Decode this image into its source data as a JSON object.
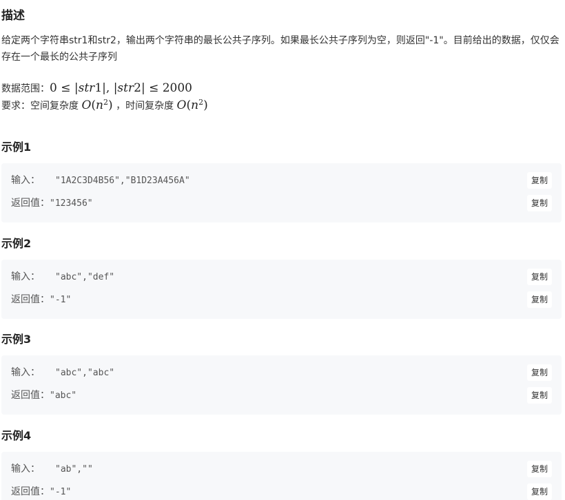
{
  "description": {
    "heading": "描述",
    "text": "给定两个字符串str1和str2，输出两个字符串的最长公共子序列。如果最长公共子序列为空，则返回\"-1\"。目前给出的数据，仅仅会存在一个最长的公共子序列",
    "range_label": "数据范围：",
    "range_math": {
      "lhs": "0",
      "le1": "≤",
      "bar_open1": "|",
      "var1": "str",
      "num1": "1",
      "bar_close1": "|",
      "comma": ",",
      "bar_open2": "|",
      "var2": "str",
      "num2": "2",
      "bar_close2": "|",
      "le2": "≤",
      "rhs": "2000"
    },
    "requirement_label": "要求：空间复杂度",
    "space_complexity": {
      "O": "O",
      "open": "(",
      "n": "n",
      "exp": "2",
      "close": ")"
    },
    "time_label": "，时间复杂度",
    "time_complexity": {
      "O": "O",
      "open": "(",
      "n": "n",
      "exp": "2",
      "close": ")"
    }
  },
  "examples": [
    {
      "title": "示例1",
      "input_label": "输入：",
      "input_value": "\"1A2C3D4B56\",\"B1D23A456A\"",
      "output_label": "返回值：",
      "output_value": "\"123456\"",
      "copy_label": "复制"
    },
    {
      "title": "示例2",
      "input_label": "输入：",
      "input_value": "\"abc\",\"def\"",
      "output_label": "返回值：",
      "output_value": "\"-1\"",
      "copy_label": "复制"
    },
    {
      "title": "示例3",
      "input_label": "输入：",
      "input_value": "\"abc\",\"abc\"",
      "output_label": "返回值：",
      "output_value": "\"abc\"",
      "copy_label": "复制"
    },
    {
      "title": "示例4",
      "input_label": "输入：",
      "input_value": "\"ab\",\"\"",
      "output_label": "返回值：",
      "output_value": "\"-1\"",
      "copy_label": "复制"
    }
  ]
}
